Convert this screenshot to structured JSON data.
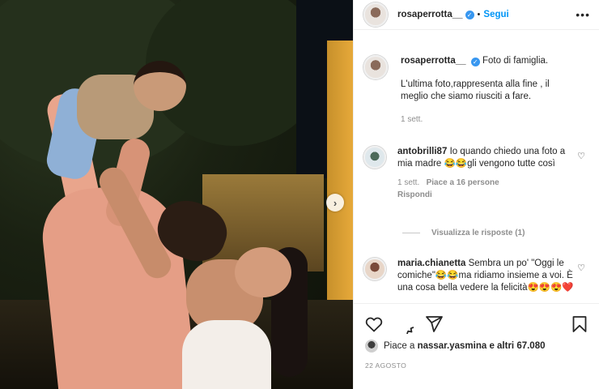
{
  "post": {
    "username": "rosaperrotta__",
    "follow_label": "Segui",
    "more_label": "•••",
    "verified_mark": "✓"
  },
  "caption": {
    "username": "rosaperrotta__",
    "text": "Foto di famiglia.",
    "text2": "L'ultima foto,rappresenta alla fine , il meglio che siamo riusciti a fare.",
    "time": "1 sett."
  },
  "comments": [
    {
      "username": "antobrilli87",
      "text": "Io quando chiedo una foto a mia madre 😂😂gli vengono tutte così",
      "time": "1 sett.",
      "likes": "Piace a 16 persone",
      "reply": "Rispondi"
    },
    {
      "username": "maria.chianetta",
      "text": "Sembra un po' \"Oggi le comiche\"😂😂ma ridiamo insieme a voi. È una cosa bella vedere la felicità😍😍😍❤️"
    }
  ],
  "view_replies": "Visualizza le risposte (1)",
  "likes_summary": {
    "prefix": "Piace a",
    "user": "nassar.yasmina",
    "rest": "e altri 67.080"
  },
  "date": "22 AGOSTO",
  "icons": [
    "heart-icon",
    "comment-icon",
    "share-icon",
    "bookmark-icon",
    "chevron-right-icon",
    "more-icon",
    "verified-icon"
  ]
}
